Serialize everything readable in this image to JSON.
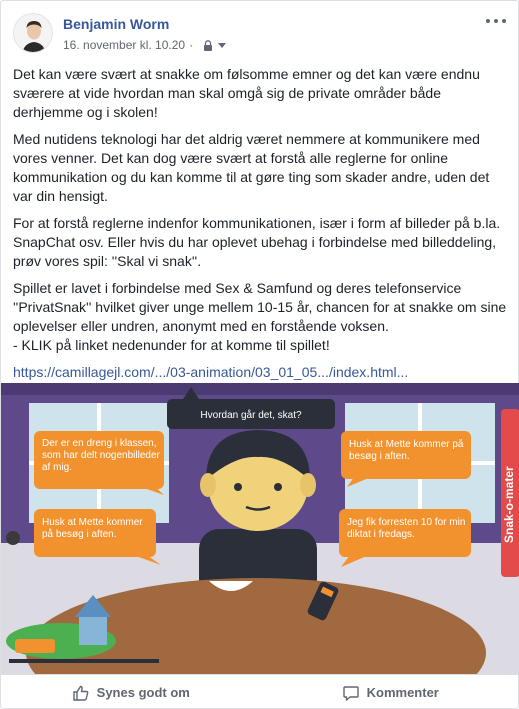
{
  "post": {
    "author": "Benjamin Worm",
    "timestamp": "16. november kl. 10.20",
    "privacy_icon": "lock-icon",
    "paragraphs": [
      "Det kan være svært at snakke om følsomme emner og det kan være endnu sværere at vide hvordan man skal omgå sig de private områder både derhjemme og i skolen!",
      "Med nutidens teknologi har det aldrig været nemmere at kommunikere med vores venner. Det kan dog være svært at forstå alle reglerne for online kommunikation og du kan komme til at gøre ting som skader andre, uden det var din hensigt.",
      "For at forstå reglerne indenfor kommunikationen, især i form af billeder på b.la. SnapChat osv. Eller hvis du har oplevet ubehag i forbindelse med billeddeling, prøv vores spil: ''Skal vi snak''.",
      "Spillet er lavet i forbindelse med Sex & Samfund og deres telefonservice ''PrivatSnak'' hvilket giver unge mellem 10-15 år, chancen for at snakke om sine oplevelser eller undren, anonymt med en forstående voksen.\n- KLIK på linket nedenunder for at komme til spillet!"
    ],
    "link": "https://camillagejl.com/.../03-animation/03_01_05.../index.html..."
  },
  "illustration": {
    "top_bubble": "Hvordan går det, skat?",
    "bubble_left_top": "Der er en dreng i klassen, som har delt nogenbilleder af mig.",
    "bubble_left_bottom": "Husk at Mette kommer på besøg i aften.",
    "bubble_right_top": "Husk at Mette kommer på besøg i aften.",
    "bubble_right_bottom": "Jeg fik forresten 10 for min diktat i fredags.",
    "side_logo": "Snak-o-mater",
    "colors": {
      "wall": "#5e4a8a",
      "table": "#a0693f",
      "bubble": "#f2922e",
      "dark_bubble": "#2a2f3a"
    }
  },
  "actions": {
    "like_label": "Synes godt om",
    "comment_label": "Kommenter"
  }
}
